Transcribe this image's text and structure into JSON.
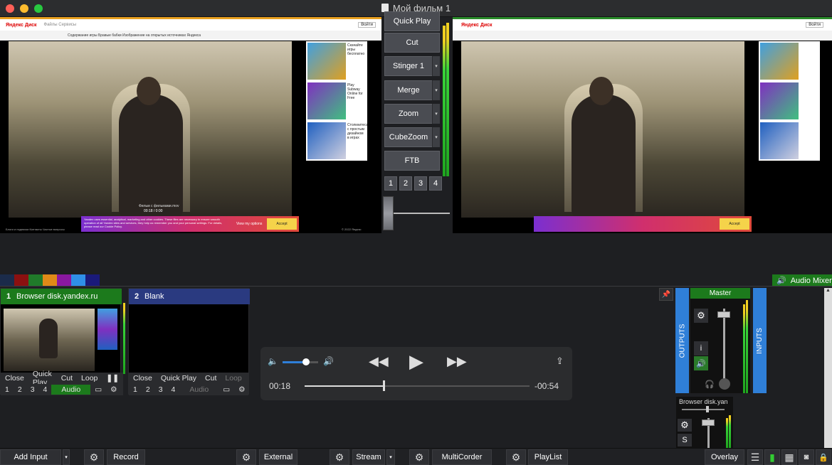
{
  "window": {
    "title": "Мой фильм 1"
  },
  "preview": {
    "site_logo": "Яндекс Диск",
    "site_nav": "Файлы   Сервисы",
    "headline": "Содержание игры Бравые бабки   Изображение на открытых источниках Яндекса",
    "top_button": "Войти",
    "video_caption": "Фильм с фильмами.mov",
    "video_counter": "00:18 / 0:00",
    "thumbs": [
      "Скачайте игры бесплатно",
      "Play Subway Online for Free",
      "Столкнитесь с простым дизайном в играх"
    ],
    "cookie_text": "Yandex uses essential, analytical, marketing and other cookies. These files are necessary to ensure smooth operation of all Yandex sites and services, they help us remember you and your personal settings. For details, please read our Cookie Policy.",
    "cookie_options": "View my options",
    "cookie_accept": "Accept",
    "footer_left": "Блоги и подписки   Контакты   Частые вопросы",
    "footer_right": "© 2022 Яндекс"
  },
  "transitions": {
    "buttons": [
      "Quick Play",
      "Cut",
      "Stinger 1",
      "Merge",
      "Zoom",
      "CubeZoom",
      "FTB"
    ],
    "dropdown_glyph": "▾",
    "numbers": [
      "1",
      "2",
      "3",
      "4"
    ]
  },
  "colors": {
    "swatches": [
      "#1b2b4a",
      "#8b1010",
      "#207a2a",
      "#e08a18",
      "#8a18a0",
      "#2f8fe8",
      "#1a1a7a"
    ],
    "accent_green": "#1c7a1c",
    "accent_blue": "#2f7fd8"
  },
  "audio_mixer_label": "Audio Mixer",
  "inputs": [
    {
      "number": "1",
      "title": "Browser disk.yandex.ru",
      "row1": [
        "Close",
        "Quick Play",
        "Cut",
        "Loop"
      ],
      "row2": [
        "1",
        "2",
        "3",
        "4"
      ],
      "audio": "Audio"
    },
    {
      "number": "2",
      "title": "Blank",
      "row1": [
        "Close",
        "Quick Play",
        "Cut",
        "Loop"
      ],
      "row2": [
        "1",
        "2",
        "3",
        "4"
      ],
      "audio": "Audio"
    }
  ],
  "player": {
    "elapsed": "00:18",
    "remaining": "-00:54",
    "progress": 0.35,
    "volume": 0.65
  },
  "mixer": {
    "master_label": "Master",
    "outputs_label": "OUTPUTS",
    "inputs_label": "INPUTS",
    "channel_label": "Browser disk.yan",
    "info_glyph": "i",
    "s_label": "S"
  },
  "bottom": {
    "add_input": "Add Input",
    "record": "Record",
    "external": "External",
    "stream": "Stream",
    "multicorder": "MultiCorder",
    "playlist": "PlayList",
    "overlay": "Overlay"
  }
}
